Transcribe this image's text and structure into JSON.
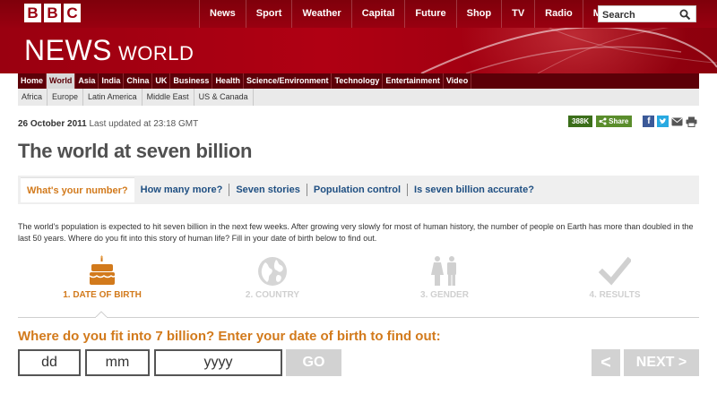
{
  "masthead": {
    "logo_letters": [
      "B",
      "B",
      "C"
    ],
    "title_news": "NEWS",
    "title_world": "WORLD"
  },
  "topnav": {
    "items": [
      "News",
      "Sport",
      "Weather",
      "Capital",
      "Future",
      "Shop",
      "TV",
      "Radio",
      "More…"
    ],
    "search_placeholder": "Search",
    "search_icon": "search-icon"
  },
  "secnav": {
    "items": [
      "Home",
      "World",
      "Asia",
      "India",
      "China",
      "UK",
      "Business",
      "Health",
      "Science/Environment",
      "Technology",
      "Entertainment",
      "Video"
    ],
    "active": "World"
  },
  "subnav": {
    "items": [
      "Africa",
      "Europe",
      "Latin America",
      "Middle East",
      "US & Canada"
    ]
  },
  "article": {
    "date": "26 October 2011",
    "updated": "Last updated at 23:18 GMT",
    "headline": "The world at seven billion",
    "intro": "The world's population is expected to hit seven billion in the next few weeks. After growing very slowly for most of human history, the number of people on Earth has more than doubled in the last 50 years. Where do you fit into this story of human life? Fill in your date of birth below to find out."
  },
  "share": {
    "count": "388K",
    "label": "Share",
    "icons": [
      "facebook-icon",
      "twitter-icon",
      "email-icon",
      "print-icon"
    ]
  },
  "tabs": [
    {
      "label": "What's your number?",
      "active": true
    },
    {
      "label": "How many more?"
    },
    {
      "label": "Seven stories"
    },
    {
      "label": "Population control"
    },
    {
      "label": "Is seven billion accurate?"
    }
  ],
  "steps": [
    {
      "label": "1. DATE OF BIRTH",
      "icon": "birthday-cake-icon",
      "active": true
    },
    {
      "label": "2. COUNTRY",
      "icon": "globe-icon"
    },
    {
      "label": "3. GENDER",
      "icon": "gender-icon"
    },
    {
      "label": "4. RESULTS",
      "icon": "checkmark-icon"
    }
  ],
  "form": {
    "question": "Where do you fit into 7 billion? Enter your date of birth to find out:",
    "day_placeholder": "dd",
    "month_placeholder": "mm",
    "year_placeholder": "yyyy",
    "go_label": "GO",
    "prev_label": "<",
    "next_label": "NEXT >"
  },
  "colors": {
    "brand_red": "#a8010f",
    "accent_orange": "#d27a1c",
    "link_blue": "#1f4f82",
    "disabled_grey": "#d2d2d2"
  }
}
